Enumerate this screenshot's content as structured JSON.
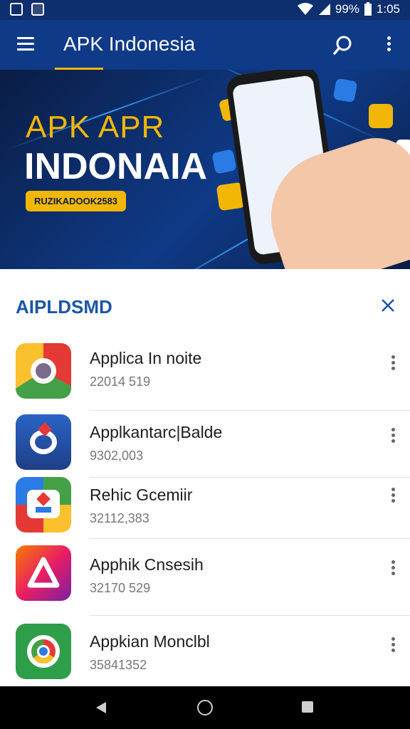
{
  "status": {
    "battery": "99%",
    "time": "1:05"
  },
  "appbar": {
    "title": "APK Indonesia"
  },
  "banner": {
    "line1": "APK APR",
    "line2": "INDONAIA",
    "badge": "RUZIKADOOK2583"
  },
  "sheet": {
    "title": "AIPLDSMD",
    "items": [
      {
        "name": "Applica In noite",
        "sub": "22014 519"
      },
      {
        "name": "Applkantarc|Balde",
        "sub": "9302,003"
      },
      {
        "name": "Rehic Gcemiir",
        "sub": "32112,383"
      },
      {
        "name": "Apphik Cnsesih",
        "sub": "32170 529"
      },
      {
        "name": "Appkian Monclbl",
        "sub": "35841352"
      }
    ]
  },
  "colors": {
    "appbar": "#0f3a87",
    "accent": "#f2b705",
    "header": "#1b56a4"
  },
  "icons": [
    "menu-icon",
    "search-icon",
    "more-icon",
    "close-icon",
    "back-icon",
    "home-icon",
    "recents-icon"
  ]
}
